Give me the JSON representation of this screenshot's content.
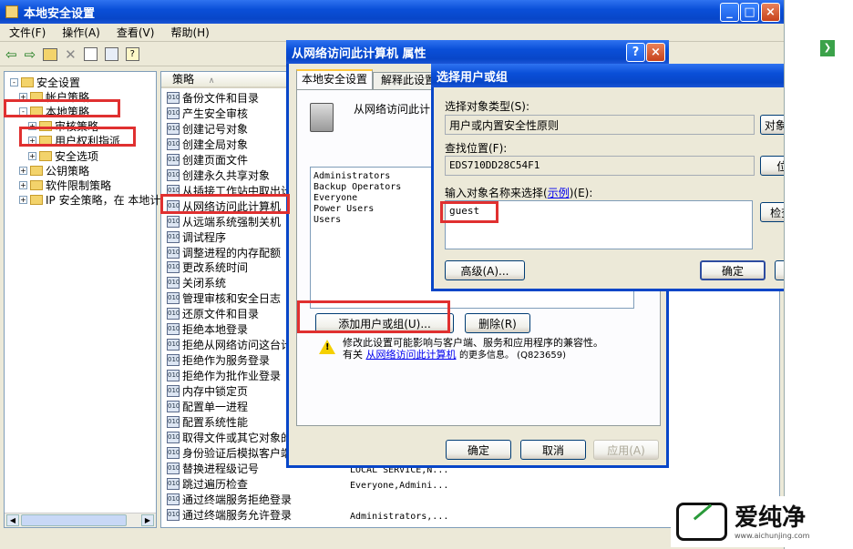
{
  "main_window": {
    "title": "本地安全设置",
    "menu": [
      "文件(F)",
      "操作(A)",
      "查看(V)",
      "帮助(H)"
    ],
    "tree": [
      {
        "label": "安全设置",
        "depth": 0,
        "expander": "-"
      },
      {
        "label": "帐户策略",
        "depth": 1,
        "expander": "+"
      },
      {
        "label": "本地策略",
        "depth": 1,
        "expander": "-"
      },
      {
        "label": "审核策略",
        "depth": 2,
        "expander": "+"
      },
      {
        "label": "用户权利指派",
        "depth": 2,
        "expander": "+"
      },
      {
        "label": "安全选项",
        "depth": 2,
        "expander": "+"
      },
      {
        "label": "公钥策略",
        "depth": 1,
        "expander": "+"
      },
      {
        "label": "软件限制策略",
        "depth": 1,
        "expander": "+"
      },
      {
        "label": "IP 安全策略，在 本地计",
        "depth": 1,
        "expander": "+"
      }
    ],
    "column_policy": "策略",
    "policies": [
      "备份文件和目录",
      "产生安全审核",
      "创建记号对象",
      "创建全局对象",
      "创建页面文件",
      "创建永久共享对象",
      "从插接工作站中取出计",
      "从网络访问此计算机",
      "从远端系统强制关机",
      "调试程序",
      "调整进程的内存配额",
      "更改系统时间",
      "关闭系统",
      "管理审核和安全日志",
      "还原文件和目录",
      "拒绝本地登录",
      "拒绝从网络访问这台计",
      "拒绝作为服务登录",
      "拒绝作为批作业登录",
      "内存中锁定页",
      "配置单一进程",
      "配置系统性能",
      "取得文件或其它对象的",
      "身份验证后模拟客户端",
      "替换进程级记号",
      "跳过遍历检查",
      "通过终端服务拒绝登录",
      "通过终端服务允许登录"
    ],
    "security_values": [
      "LOCAL SERVICE,N...",
      "Everyone,Admini...",
      "Administrators,..."
    ]
  },
  "properties_dialog": {
    "title": "从网络访问此计算机 属性",
    "tabs": [
      "本地安全设置",
      "解释此设置"
    ],
    "policy_name": "从网络访问此计",
    "members": [
      "Administrators",
      "Backup Operators",
      "Everyone",
      "Power Users",
      "Users"
    ],
    "add_button": "添加用户或组(U)...",
    "remove_button": "删除(R)",
    "warning_line1": "修改此设置可能影响与客户端、服务和应用程序的兼容性。",
    "warning_prefix": "有关",
    "warning_link": "从网络访问此计算机",
    "warning_suffix": "的更多信息。 (Q823659)",
    "ok": "确定",
    "cancel": "取消",
    "apply": "应用(A)"
  },
  "select_dialog": {
    "title": "选择用户或组",
    "object_type_label": "选择对象类型(S):",
    "object_type_value": "用户或内置安全性原则",
    "object_type_button": "对象类型(O)...",
    "location_label": "查找位置(F):",
    "location_value": "EDS710DD28C54F1",
    "location_button": "位置(L)...",
    "names_label_prefix": "输入对象名称来选择(",
    "names_label_link": "示例",
    "names_label_suffix": ")(E):",
    "names_value": "guest",
    "check_names_button": "检查名称(C)",
    "advanced_button": "高级(A)...",
    "ok": "确定",
    "cancel": "取消"
  },
  "watermark": {
    "brand": "爱纯净",
    "url": "www.aichunjing.com"
  }
}
